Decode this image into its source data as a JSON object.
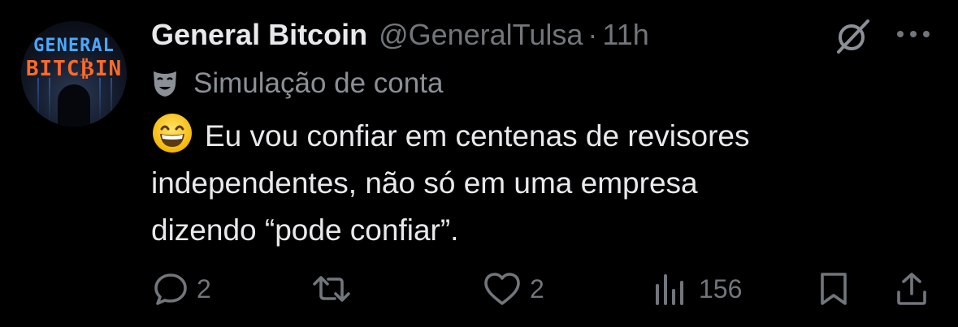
{
  "tweet": {
    "author": {
      "display_name": "General Bitcoin",
      "handle": "@GeneralTulsa",
      "avatar_text_line1": "GENERAL",
      "avatar_text_line2": "BITC₿IN"
    },
    "separator": "·",
    "time": "11h",
    "account_label": "Simulação de conta",
    "text_line1": "Eu vou confiar em centenas de revisores",
    "text_line2": "independentes, não só em uma empresa",
    "text_line3": "dizendo “pode confiar”.",
    "icons": {
      "grok": "grok-icon",
      "more": "more-icon",
      "label": "theater-mask-icon",
      "emoji": "grinning-face-emoji"
    },
    "actions": {
      "replies": "2",
      "reposts": "",
      "likes": "2",
      "views": "156"
    },
    "colors": {
      "background": "#000000",
      "text": "#e7e9ea",
      "secondary": "#71767b"
    }
  }
}
